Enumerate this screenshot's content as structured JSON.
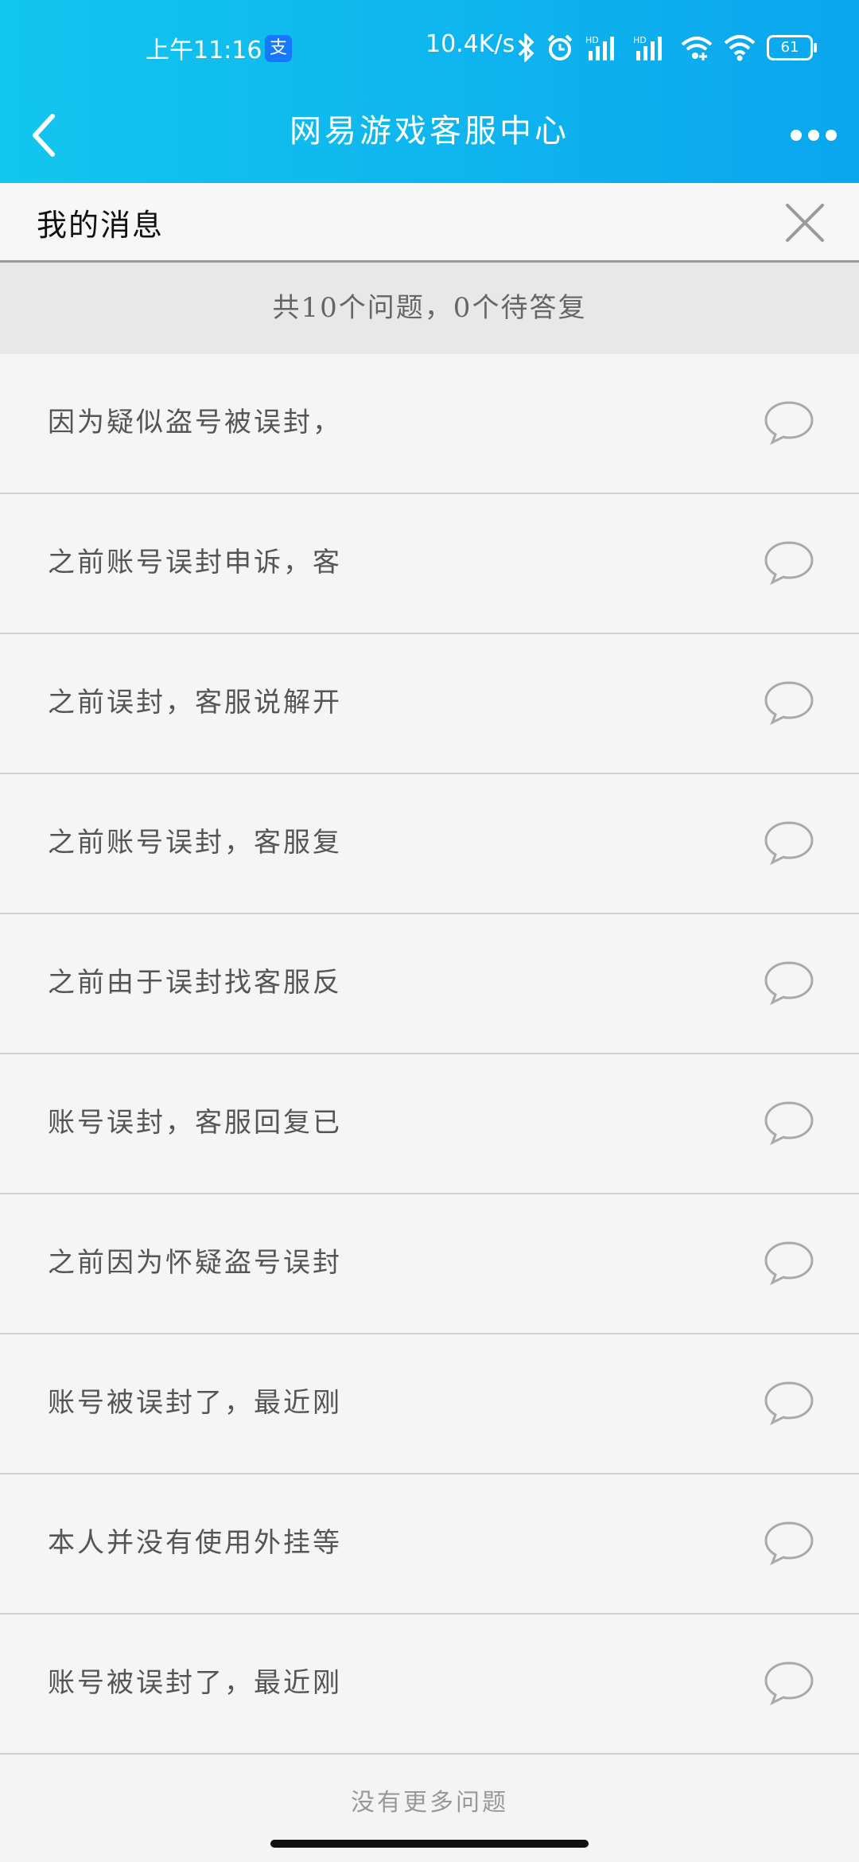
{
  "status": {
    "time": "上午11:16",
    "alipay_badge": "支",
    "speed": "10.4K/s",
    "battery": "61",
    "icons": [
      "bluetooth-icon",
      "alarm-icon",
      "signal-hd-1-icon",
      "signal-hd-2-icon",
      "wifi-hotspot-icon",
      "wifi-icon",
      "battery-icon"
    ]
  },
  "nav": {
    "title": "网易游戏客服中心"
  },
  "messages": {
    "label": "我的消息",
    "summary": "共10个问题，0个待答复",
    "items": [
      {
        "text": "因为疑似盗号被误封，"
      },
      {
        "text": "之前账号误封申诉，客"
      },
      {
        "text": "之前误封，客服说解开"
      },
      {
        "text": "之前账号误封，客服复"
      },
      {
        "text": "之前由于误封找客服反"
      },
      {
        "text": "账号误封，客服回复已"
      },
      {
        "text": "之前因为怀疑盗号误封"
      },
      {
        "text": "账号被误封了，最近刚"
      },
      {
        "text": "本人并没有使用外挂等"
      },
      {
        "text": "账号被误封了，最近刚"
      }
    ],
    "footer": "没有更多问题"
  },
  "colors": {
    "header_start": "#12c6ee",
    "header_end": "#0aa6ee",
    "text_primary": "#555555",
    "divider": "#cfcfcf"
  }
}
